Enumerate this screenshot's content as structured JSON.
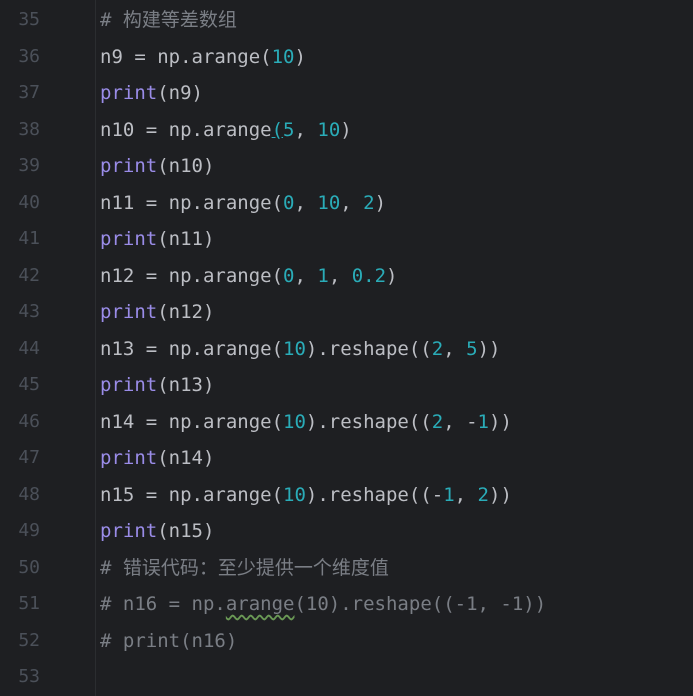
{
  "lines": [
    {
      "ln": "35",
      "tokens": [
        {
          "t": "# ",
          "c": "tok-cmt"
        },
        {
          "t": "构建等差数组",
          "c": "tok-cn"
        }
      ]
    },
    {
      "ln": "36",
      "tokens": [
        {
          "t": "n9 = np.arange(",
          "c": ""
        },
        {
          "t": "10",
          "c": "tok-num"
        },
        {
          "t": ")",
          "c": ""
        }
      ]
    },
    {
      "ln": "37",
      "tokens": [
        {
          "t": "print",
          "c": "tok-fn"
        },
        {
          "t": "(n9)",
          "c": ""
        }
      ]
    },
    {
      "ln": "38",
      "tokens": [
        {
          "t": "n10 = np.arange",
          "c": ""
        },
        {
          "t": "(",
          "c": "caret-paren"
        },
        {
          "t": "5",
          "c": "tok-num"
        },
        {
          "t": ", ",
          "c": ""
        },
        {
          "t": "10",
          "c": "tok-num"
        },
        {
          "t": ")",
          "c": ""
        }
      ]
    },
    {
      "ln": "39",
      "tokens": [
        {
          "t": "print",
          "c": "tok-fn"
        },
        {
          "t": "(n10)",
          "c": ""
        }
      ]
    },
    {
      "ln": "40",
      "tokens": [
        {
          "t": "n11 = np.arange(",
          "c": ""
        },
        {
          "t": "0",
          "c": "tok-num"
        },
        {
          "t": ", ",
          "c": ""
        },
        {
          "t": "10",
          "c": "tok-num"
        },
        {
          "t": ", ",
          "c": ""
        },
        {
          "t": "2",
          "c": "tok-num"
        },
        {
          "t": ")",
          "c": ""
        }
      ]
    },
    {
      "ln": "41",
      "tokens": [
        {
          "t": "print",
          "c": "tok-fn"
        },
        {
          "t": "(n11)",
          "c": ""
        }
      ]
    },
    {
      "ln": "42",
      "tokens": [
        {
          "t": "n12 = np.arange(",
          "c": ""
        },
        {
          "t": "0",
          "c": "tok-num"
        },
        {
          "t": ", ",
          "c": ""
        },
        {
          "t": "1",
          "c": "tok-num"
        },
        {
          "t": ", ",
          "c": ""
        },
        {
          "t": "0.2",
          "c": "tok-num"
        },
        {
          "t": ")",
          "c": ""
        }
      ]
    },
    {
      "ln": "43",
      "tokens": [
        {
          "t": "print",
          "c": "tok-fn"
        },
        {
          "t": "(n12)",
          "c": ""
        }
      ]
    },
    {
      "ln": "44",
      "tokens": [
        {
          "t": "n13 = np.arange(",
          "c": ""
        },
        {
          "t": "10",
          "c": "tok-num"
        },
        {
          "t": ").reshape((",
          "c": ""
        },
        {
          "t": "2",
          "c": "tok-num"
        },
        {
          "t": ", ",
          "c": ""
        },
        {
          "t": "5",
          "c": "tok-num"
        },
        {
          "t": "))",
          "c": ""
        }
      ]
    },
    {
      "ln": "45",
      "tokens": [
        {
          "t": "print",
          "c": "tok-fn"
        },
        {
          "t": "(n13)",
          "c": ""
        }
      ]
    },
    {
      "ln": "46",
      "tokens": [
        {
          "t": "n14 = np.arange(",
          "c": ""
        },
        {
          "t": "10",
          "c": "tok-num"
        },
        {
          "t": ").reshape((",
          "c": ""
        },
        {
          "t": "2",
          "c": "tok-num"
        },
        {
          "t": ", -",
          "c": ""
        },
        {
          "t": "1",
          "c": "tok-num"
        },
        {
          "t": "))",
          "c": ""
        }
      ]
    },
    {
      "ln": "47",
      "tokens": [
        {
          "t": "print",
          "c": "tok-fn"
        },
        {
          "t": "(n14)",
          "c": ""
        }
      ]
    },
    {
      "ln": "48",
      "tokens": [
        {
          "t": "n15 = np.arange(",
          "c": ""
        },
        {
          "t": "10",
          "c": "tok-num"
        },
        {
          "t": ").reshape((-",
          "c": ""
        },
        {
          "t": "1",
          "c": "tok-num"
        },
        {
          "t": ", ",
          "c": ""
        },
        {
          "t": "2",
          "c": "tok-num"
        },
        {
          "t": "))",
          "c": ""
        }
      ]
    },
    {
      "ln": "49",
      "tokens": [
        {
          "t": "print",
          "c": "tok-fn"
        },
        {
          "t": "(n15)",
          "c": ""
        }
      ]
    },
    {
      "ln": "50",
      "tokens": [
        {
          "t": "# ",
          "c": "tok-cmt"
        },
        {
          "t": "错误代码：至少提供一个维度值",
          "c": "tok-cn"
        }
      ]
    },
    {
      "ln": "51",
      "tokens": [
        {
          "t": "# n16 = np.",
          "c": "tok-cmt"
        },
        {
          "t": "arange",
          "c": "tok-cmt tok-squiggle"
        },
        {
          "t": "(10).reshape((-1, -1))",
          "c": "tok-cmt"
        }
      ]
    },
    {
      "ln": "52",
      "tokens": [
        {
          "t": "# print(n16)",
          "c": "tok-cmt"
        }
      ]
    },
    {
      "ln": "53",
      "tokens": []
    }
  ]
}
